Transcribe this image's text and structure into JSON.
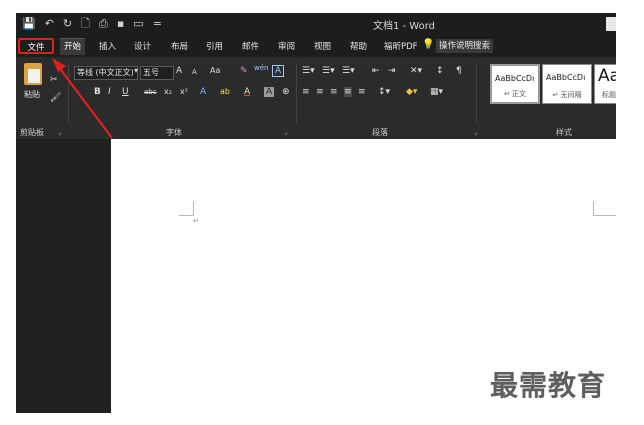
{
  "window": {
    "title": "文档1 - Word",
    "quick_access": [
      "💾",
      "↶",
      "↻",
      "🗋",
      "⎙",
      "▪",
      "▭",
      "="
    ]
  },
  "tabs": {
    "file": "文件",
    "home": "开始",
    "insert": "插入",
    "design": "设计",
    "layout": "布局",
    "references": "引用",
    "mailings": "邮件",
    "review": "审阅",
    "view": "视图",
    "help": "帮助",
    "foxit_pdf": "福昕PDF",
    "search_icon": "lightbulb-icon",
    "search_label": "操作说明搜索"
  },
  "ribbon": {
    "clipboard": {
      "paste_label": "粘贴",
      "group_label": "剪贴板"
    },
    "font": {
      "font_name": "等线 (中文正文)",
      "font_size": "五号",
      "grow": "A",
      "shrink": "A",
      "change_case": "Aa",
      "clear_format": "✎",
      "phonetic": "wén",
      "char_border": "A",
      "bold": "B",
      "italic": "I",
      "underline": "U",
      "strike": "abc",
      "subscript": "x₂",
      "superscript": "x²",
      "text_effects": "A",
      "highlight": "ab",
      "font_color": "A",
      "char_shading": "A",
      "enclose": "⊕",
      "group_label": "字体"
    },
    "paragraph": {
      "group_label": "段落"
    },
    "styles": {
      "cards": [
        {
          "sample": "AaBbCcDı",
          "name": "↵ 正文"
        },
        {
          "sample": "AaBbCcDı",
          "name": "↵ 无间隔"
        },
        {
          "sample": "Aa",
          "name": "标题"
        }
      ],
      "group_label": "样式"
    }
  },
  "document": {
    "paragraph_mark": "↵"
  },
  "annotation": {
    "highlight_color": "#e0201c"
  },
  "watermark": "最需教育"
}
